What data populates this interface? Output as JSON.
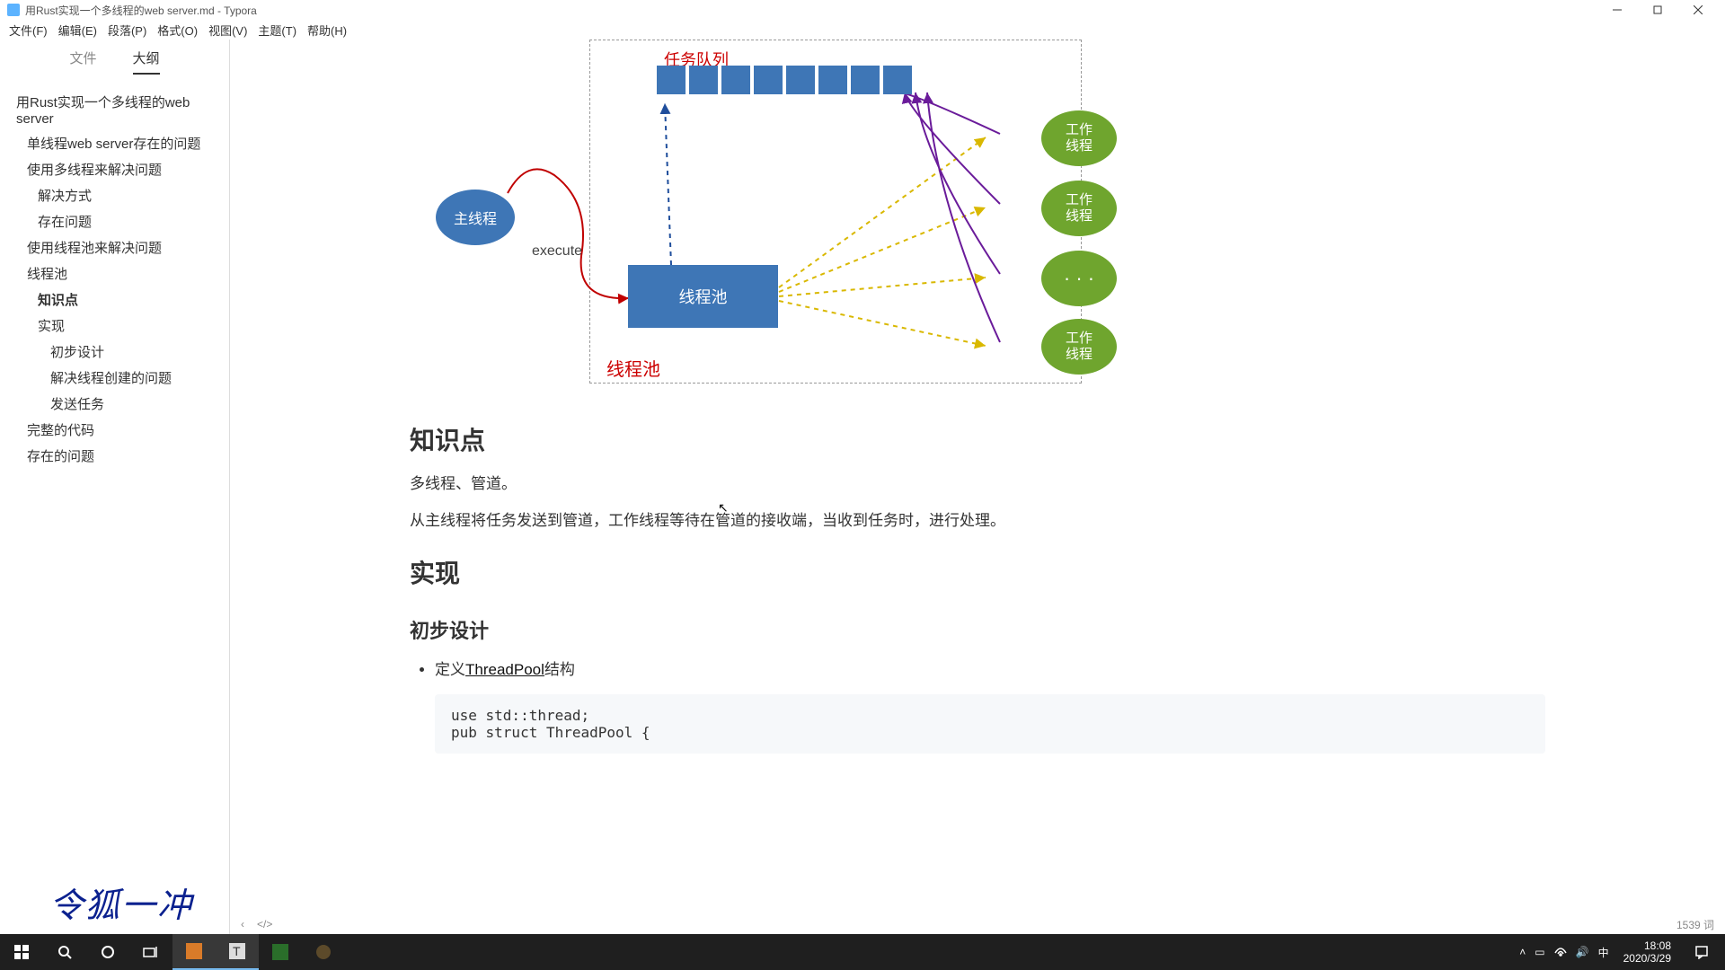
{
  "window": {
    "title": "用Rust实现一个多线程的web server.md - Typora"
  },
  "menu": {
    "file": "文件(F)",
    "edit": "编辑(E)",
    "paragraph": "段落(P)",
    "format": "格式(O)",
    "view": "视图(V)",
    "theme": "主题(T)",
    "help": "帮助(H)"
  },
  "sidebar": {
    "tab_files": "文件",
    "tab_outline": "大纲",
    "watermark": "令狐一冲",
    "outline": [
      {
        "t": "用Rust实现一个多线程的web server",
        "lvl": 1,
        "active": false
      },
      {
        "t": "单线程web server存在的问题",
        "lvl": 2,
        "active": false
      },
      {
        "t": "使用多线程来解决问题",
        "lvl": 2,
        "active": false
      },
      {
        "t": "解决方式",
        "lvl": 3,
        "active": false
      },
      {
        "t": "存在问题",
        "lvl": 3,
        "active": false
      },
      {
        "t": "使用线程池来解决问题",
        "lvl": 2,
        "active": false
      },
      {
        "t": "线程池",
        "lvl": 2,
        "active": false
      },
      {
        "t": "知识点",
        "lvl": 3,
        "active": true
      },
      {
        "t": "实现",
        "lvl": 3,
        "active": false
      },
      {
        "t": "初步设计",
        "lvl": 4,
        "active": false
      },
      {
        "t": "解决线程创建的问题",
        "lvl": 4,
        "active": false
      },
      {
        "t": "发送任务",
        "lvl": 4,
        "active": false
      },
      {
        "t": "完整的代码",
        "lvl": 2,
        "active": false
      },
      {
        "t": "存在的问题",
        "lvl": 2,
        "active": false
      }
    ]
  },
  "diagram": {
    "task_queue": "任务队列",
    "main_thread": "主线程",
    "execute": "execute",
    "thread_pool_box": "线程池",
    "pool_label": "线程池",
    "worker": "工作\n线程",
    "ellipsis": "· · ·"
  },
  "article": {
    "h_knowledge": "知识点",
    "p1": "多线程、管道。",
    "p2": "从主线程将任务发送到管道，工作线程等待在管道的接收端，当收到任务时，进行处理。",
    "h_impl": "实现",
    "h_initial": "初步设计",
    "li1_pre": "定义",
    "li1_link": "ThreadPool",
    "li1_post": "结构",
    "code": "use std::thread;\npub struct ThreadPool {"
  },
  "status": {
    "word_count": "1539 词",
    "back": "‹",
    "source": "</>"
  },
  "taskbar": {
    "time": "18:08",
    "date": "2020/3/29",
    "ime": "中"
  }
}
